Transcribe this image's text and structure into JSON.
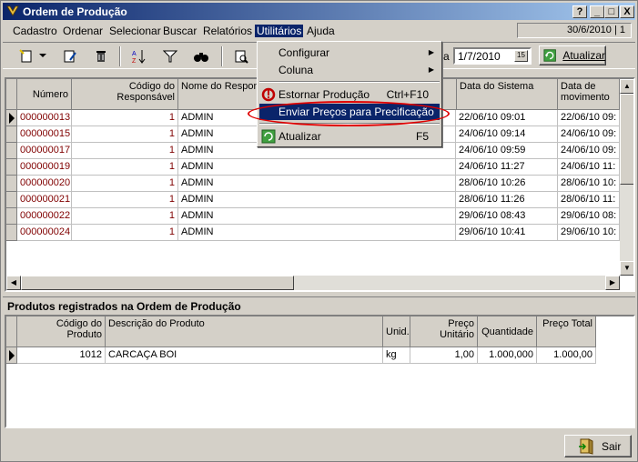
{
  "window": {
    "title": "Ordem de Produção"
  },
  "titlebar_buttons": {
    "help": "?",
    "minimize": "_",
    "maximize": "□",
    "close": "X"
  },
  "menu": [
    "Cadastro",
    "Ordenar",
    "Selecionar",
    "Buscar",
    "Relatórios",
    "Utilitários",
    "Ajuda"
  ],
  "status_date": "30/6/2010 | 1",
  "toolbar": {
    "date_prefix": "a",
    "date_value": "1/7/2010",
    "calendar_label": "15",
    "update_label": "Atualizar"
  },
  "dropdown": {
    "items": [
      {
        "label": "Configurar",
        "shortcut": "",
        "submenu": true
      },
      {
        "label": "Coluna",
        "shortcut": "",
        "submenu": true
      },
      {
        "label": "Estornar Produção",
        "shortcut": "Ctrl+F10",
        "submenu": false
      },
      {
        "label": "Enviar Preços para Precificação",
        "shortcut": "",
        "submenu": false
      },
      {
        "label": "Atualizar",
        "shortcut": "F5",
        "submenu": false
      }
    ]
  },
  "orders_table": {
    "headers": {
      "numero": "Número",
      "codigo": "Código do Responsável",
      "nome": "Nome do Responsável",
      "data_sistema": "Data do Sistema",
      "data_mov": "Data de movimento"
    },
    "rows": [
      {
        "numero": "000000013",
        "codigo": "1",
        "nome": "ADMIN",
        "data_sistema": "22/06/10  09:01",
        "data_mov": "22/06/10  09:"
      },
      {
        "numero": "000000015",
        "codigo": "1",
        "nome": "ADMIN",
        "data_sistema": "24/06/10  09:14",
        "data_mov": "24/06/10  09:"
      },
      {
        "numero": "000000017",
        "codigo": "1",
        "nome": "ADMIN",
        "data_sistema": "24/06/10  09:59",
        "data_mov": "24/06/10  09:"
      },
      {
        "numero": "000000019",
        "codigo": "1",
        "nome": "ADMIN",
        "data_sistema": "24/06/10  11:27",
        "data_mov": "24/06/10  11:"
      },
      {
        "numero": "000000020",
        "codigo": "1",
        "nome": "ADMIN",
        "data_sistema": "28/06/10  10:26",
        "data_mov": "28/06/10  10:"
      },
      {
        "numero": "000000021",
        "codigo": "1",
        "nome": "ADMIN",
        "data_sistema": "28/06/10  11:26",
        "data_mov": "28/06/10  11:"
      },
      {
        "numero": "000000022",
        "codigo": "1",
        "nome": "ADMIN",
        "data_sistema": "29/06/10  08:43",
        "data_mov": "29/06/10  08:"
      },
      {
        "numero": "000000024",
        "codigo": "1",
        "nome": "ADMIN",
        "data_sistema": "29/06/10  10:41",
        "data_mov": "29/06/10  10:"
      }
    ]
  },
  "products_section": {
    "title": "Produtos registrados na Ordem de Produção"
  },
  "products_table": {
    "headers": {
      "codigo": "Código do Produto",
      "descricao": "Descrição do Produto",
      "unid": "Unid.",
      "preco_unit": "Preço Unitário",
      "quantidade": "Quantidade",
      "preco_total": "Preço Total"
    },
    "rows": [
      {
        "codigo": "1012",
        "descricao": "CARCAÇA BOI",
        "unid": "kg",
        "preco_unit": "1,00",
        "quantidade": "1.000,000",
        "preco_total": "1.000,00"
      }
    ]
  },
  "exit_button": {
    "label": "Sair"
  },
  "colors": {
    "title_start": "#0a246a",
    "title_end": "#a6caf0",
    "highlight": "#0a246a",
    "annotation": "#e00000",
    "number_text": "#800000"
  }
}
